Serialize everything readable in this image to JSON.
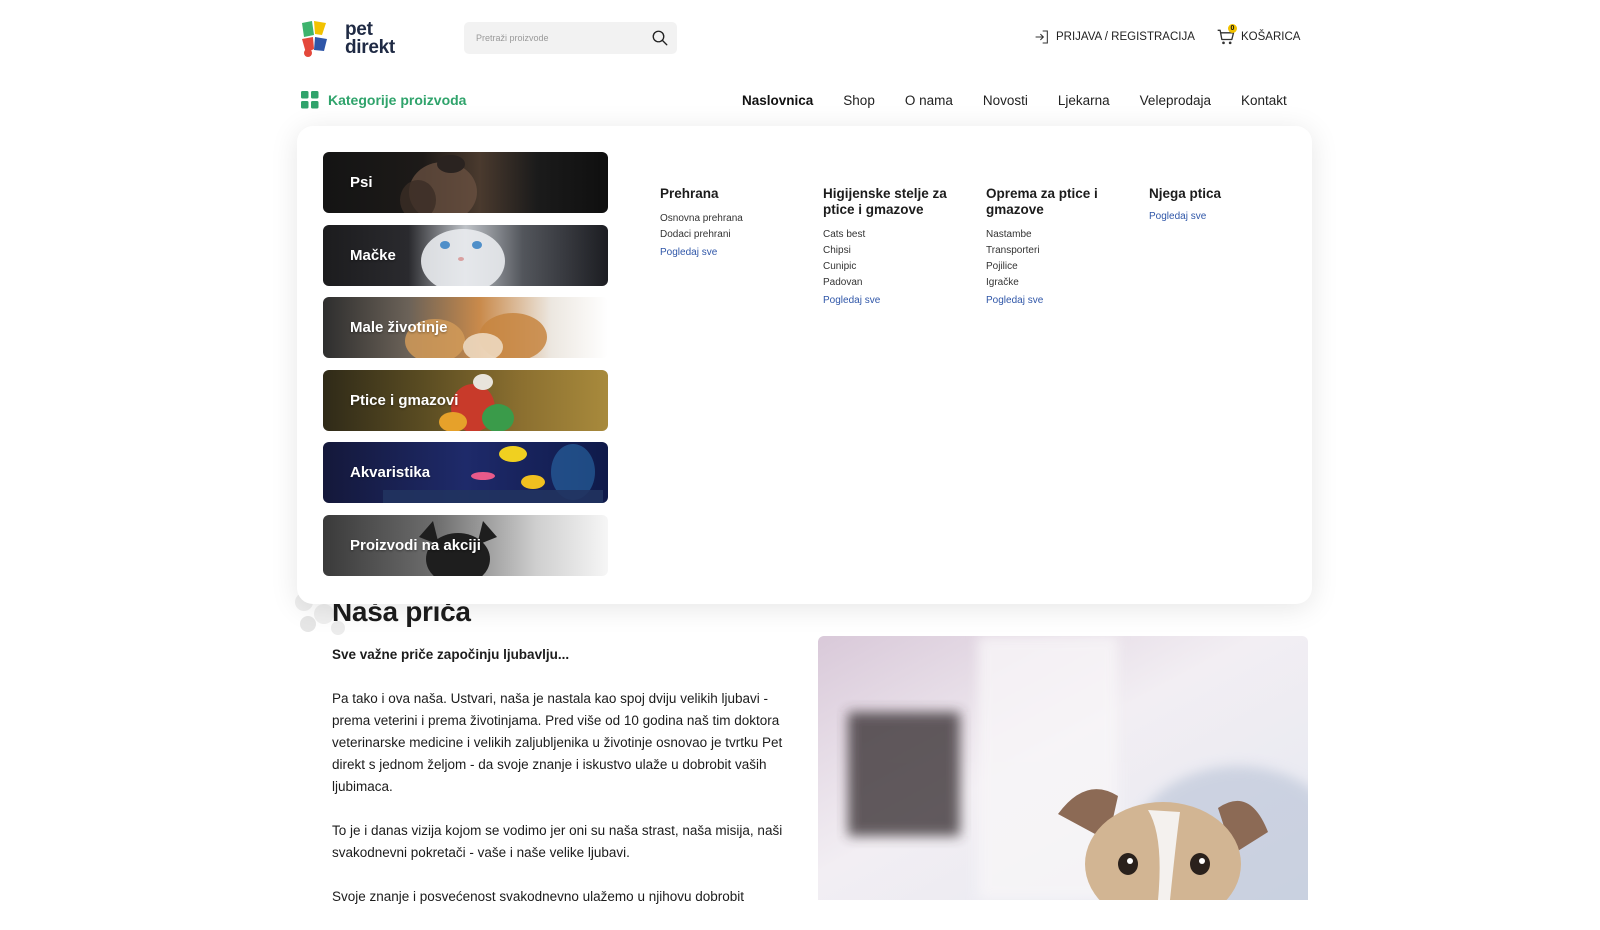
{
  "brand": {
    "logo_line1": "pet",
    "logo_line2": "direkt"
  },
  "header": {
    "search_placeholder": "Pretraži proizvode",
    "login_label": "PRIJAVA / REGISTRACIJA",
    "cart_label": "KOŠARICA",
    "cart_count": "0"
  },
  "nav": {
    "categories_label": "Kategorije proizvoda",
    "items": [
      "Naslovnica",
      "Shop",
      "O nama",
      "Novosti",
      "Ljekarna",
      "Veleprodaja",
      "Kontakt"
    ],
    "active": "Naslovnica"
  },
  "mega_menu": {
    "categories": [
      "Psi",
      "Mačke",
      "Male životinje",
      "Ptice i gmazovi",
      "Akvaristika",
      "Proizvodi na akciji"
    ],
    "columns": [
      {
        "title": "Prehrana",
        "items": [
          "Osnovna prehrana",
          "Dodaci prehrani"
        ],
        "view_all": "Pogledaj sve"
      },
      {
        "title": "Higijenske stelje za ptice i gmazove",
        "items": [
          "Cats best",
          "Chipsi",
          "Cunipic",
          "Padovan"
        ],
        "view_all": "Pogledaj sve"
      },
      {
        "title": "Oprema za ptice i gmazove",
        "items": [
          "Nastambe",
          "Transporteri",
          "Pojilice",
          "Igračke"
        ],
        "view_all": "Pogledaj sve"
      },
      {
        "title": "Njega ptica",
        "items": [],
        "view_all": "Pogledaj sve"
      }
    ]
  },
  "story": {
    "title": "Naša priča",
    "lead": "Sve važne priče započinju ljubavlju...",
    "paragraphs": [
      "Pa tako i ova naša. Ustvari, naša je nastala kao spoj dviju velikih ljubavi - prema veterini i prema životinjama. Pred više od 10 godina naš tim doktora veterinarske medicine i velikih zaljubljenika u životinje osnovao je tvrtku Pet direkt s jednom željom - da svoje znanje i iskustvo ulaže u dobrobit vaših ljubimaca.",
      "To je i danas vizija kojom se vodimo jer oni su naša strast, naša misija, naši svakodnevni pokretači - vaše i naše velike ljubavi.",
      "Svoje znanje i posvećenost svakodnevno ulažemo u njihovu dobrobit"
    ]
  },
  "colors": {
    "accent_green": "#2fa36b",
    "link_blue": "#2f56a8",
    "badge_yellow": "#f2c200"
  }
}
